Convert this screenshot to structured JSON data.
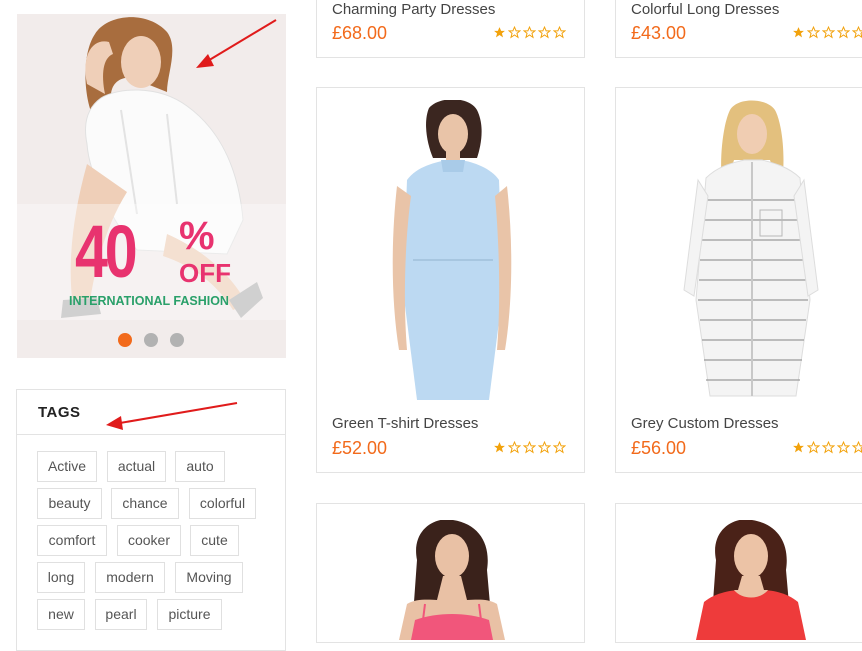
{
  "banner": {
    "promo_value": "40",
    "promo_sign": "%",
    "promo_off": "OFF",
    "promo_caption": "INTERNATIONAL FASHION",
    "slides": 3,
    "active_slide": 1,
    "colors": {
      "accent": "#e8336f",
      "caption": "#2aa06a",
      "dot_active": "#f26a1b",
      "dot": "#b2b2b2"
    }
  },
  "tags": {
    "title": "TAGS",
    "items": [
      "Active",
      "actual",
      "auto",
      "beauty",
      "chance",
      "colorful",
      "comfort",
      "cooker",
      "cute",
      "long",
      "modern",
      "Moving",
      "new",
      "pearl",
      "picture"
    ]
  },
  "products": [
    {
      "name": "Charming Party Dresses",
      "price": "£68.00",
      "rating": 1,
      "max_rating": 5
    },
    {
      "name": "Colorful Long Dresses",
      "price": "£43.00",
      "rating": 1,
      "max_rating": 5
    },
    {
      "name": "Green T-shirt Dresses",
      "price": "£52.00",
      "rating": 1,
      "max_rating": 5
    },
    {
      "name": "Grey Custom Dresses",
      "price": "£56.00",
      "rating": 1,
      "max_rating": 5
    },
    {
      "name": "",
      "price": "",
      "rating": 0,
      "max_rating": 0
    },
    {
      "name": "",
      "price": "",
      "rating": 0,
      "max_rating": 0
    }
  ],
  "theme": {
    "price_color": "#f26a1b",
    "star_color": "#f2a20c",
    "arrow_color": "#e01b1b"
  }
}
